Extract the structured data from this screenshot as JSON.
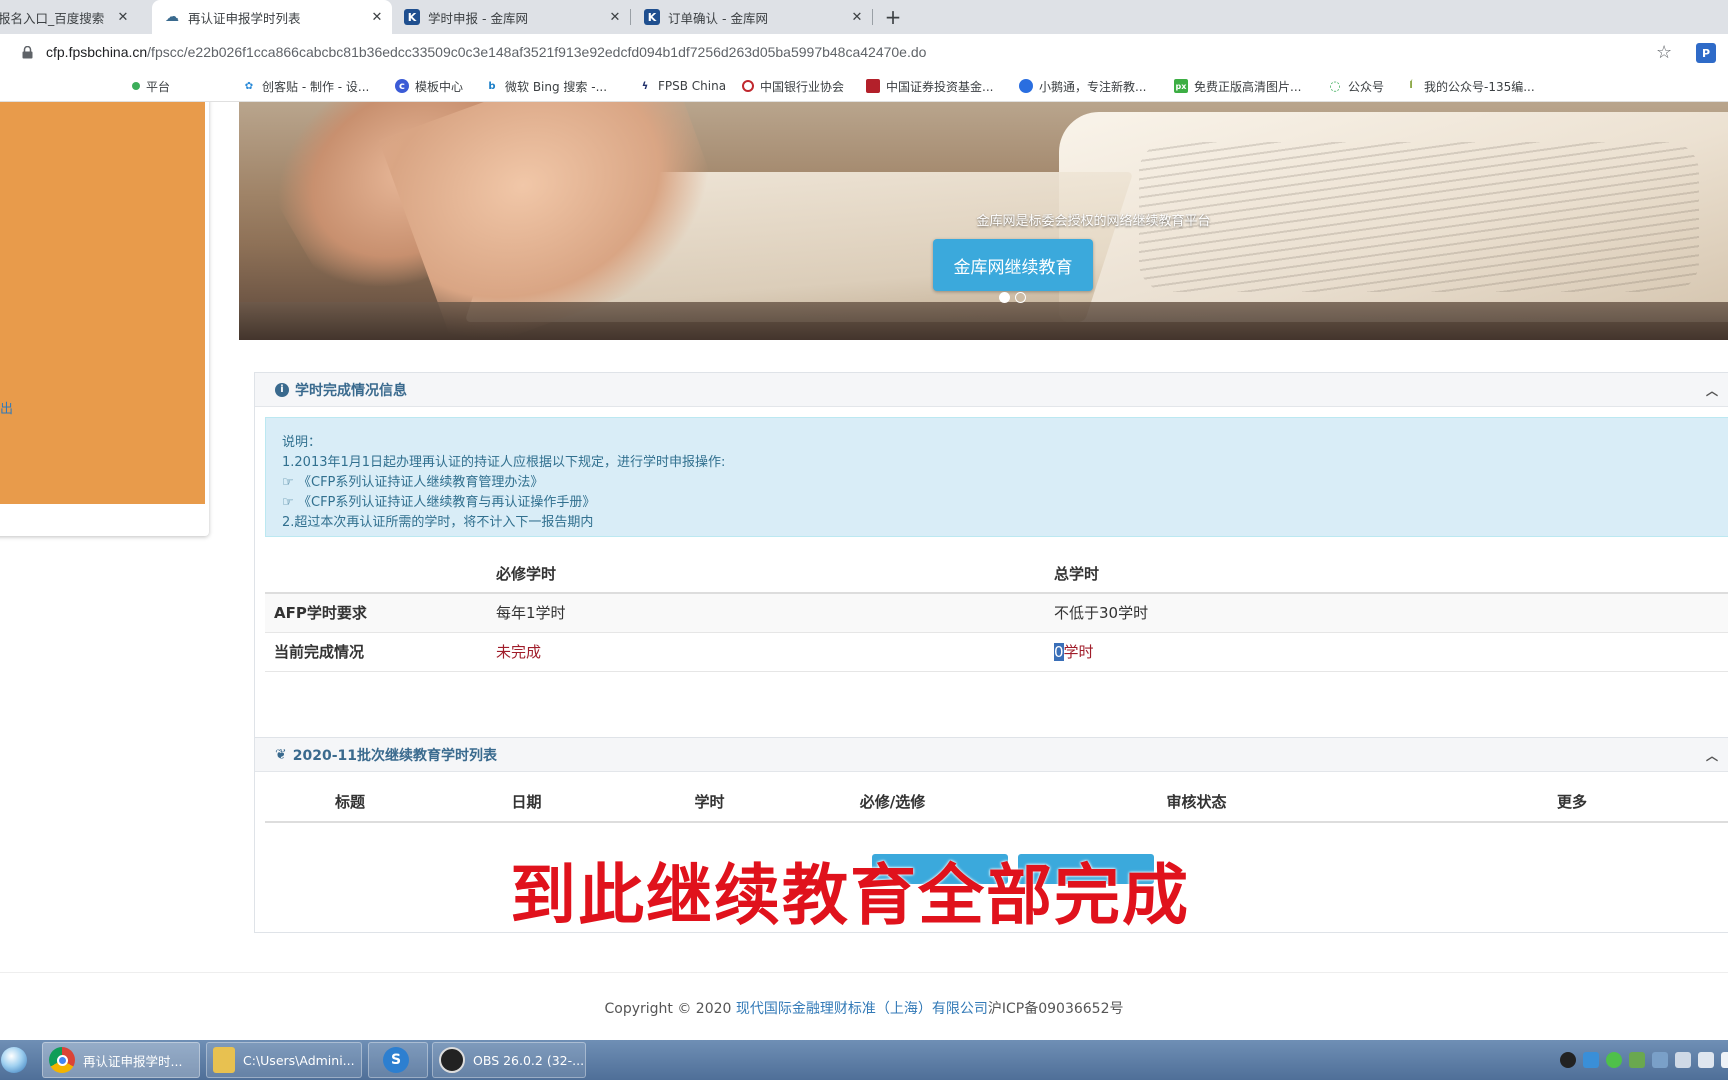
{
  "browser": {
    "tabs": [
      {
        "title": "报名入口_百度搜索",
        "icon": "baidu-icon",
        "active": false
      },
      {
        "title": "再认证申报学时列表",
        "icon": "cloud-icon",
        "active": true
      },
      {
        "title": "学时申报 - 金库网",
        "icon": "jinku-k-icon",
        "active": false
      },
      {
        "title": "订单确认 - 金库网",
        "icon": "jinku-k-icon",
        "active": false
      }
    ],
    "url_host": "cfp.fpsbchina.cn",
    "url_path": "/fpscc/e22b026f1cca866cabcbc81b36edcc33509c0c3e148af3521f913e92edcfd094b1df7256d263d05ba5997b48ca42470e.do",
    "bookmarks": [
      {
        "label": "平台",
        "icon": "green-icon"
      },
      {
        "label": "创客贴 - 制作 - 设...",
        "icon": "chuangketie-icon"
      },
      {
        "label": "模板中心",
        "icon": "c-icon"
      },
      {
        "label": "微软 Bing 搜索 -...",
        "icon": "bing-icon"
      },
      {
        "label": "FPSB China",
        "icon": "fpsb-icon"
      },
      {
        "label": "中国银行业协会",
        "icon": "bank-assoc-icon"
      },
      {
        "label": "中国证券投资基金...",
        "icon": "fund-assoc-icon"
      },
      {
        "label": "小鹅通，专注新教...",
        "icon": "xiaoetong-icon"
      },
      {
        "label": "免费正版高清图片...",
        "icon": "px-icon"
      },
      {
        "label": "公众号",
        "icon": "wechat-mp-icon"
      },
      {
        "label": "我的公众号-135编...",
        "icon": "135-icon"
      }
    ]
  },
  "sidebar": {
    "link_text": "出"
  },
  "banner": {
    "subtitle": "金库网是标委会授权的网络继续教育平台",
    "button_label": "金库网继续教育",
    "slides": [
      true,
      false
    ]
  },
  "progress_panel": {
    "title": "学时完成情况信息",
    "notice": {
      "heading": "说明：",
      "line1": "1.2013年1月1日起办理再认证的持证人应根据以下规定，进行学时申报操作:",
      "link1": "《CFP系列认证持证人继续教育管理办法》",
      "link2": "《CFP系列认证持证人继续教育与再认证操作手册》",
      "line2": "2.超过本次再认证所需的学时，将不计入下一报告期内"
    },
    "table": {
      "headers": [
        "",
        "必修学时",
        "总学时"
      ],
      "rows": [
        {
          "label": "AFP学时要求",
          "required": "每年1学时",
          "total": "不低于30学时"
        },
        {
          "label": "当前完成情况",
          "required": "未完成",
          "total_selected": "0",
          "total_rest": "学时"
        }
      ]
    }
  },
  "list_panel": {
    "title": "2020-11批次继续教育学时列表",
    "headers": [
      "标题",
      "日期",
      "学时",
      "必修/选修",
      "审核状态",
      "更多"
    ]
  },
  "caption": "到此继续教育全部完成",
  "footer": {
    "prefix": "Copyright © 2020 ",
    "company": "现代国际金融理财标准（上海）有限公司",
    "icp": "沪ICP备09036652号"
  },
  "taskbar": {
    "items": [
      {
        "label": "再认证申报学时...",
        "icon": "chrome-icon"
      },
      {
        "label": "C:\\Users\\Admini...",
        "icon": "folder-icon"
      },
      {
        "label": "",
        "icon": "sogou-icon"
      },
      {
        "label": "OBS 26.0.2 (32-...",
        "icon": "obs-icon"
      }
    ]
  },
  "colors": {
    "accent": "#3ba9dc",
    "panel_title": "#3a6a8e",
    "caption_red": "#e0121c",
    "status_red": "#a01d2a",
    "sidebar_orange": "#e89b4b"
  }
}
